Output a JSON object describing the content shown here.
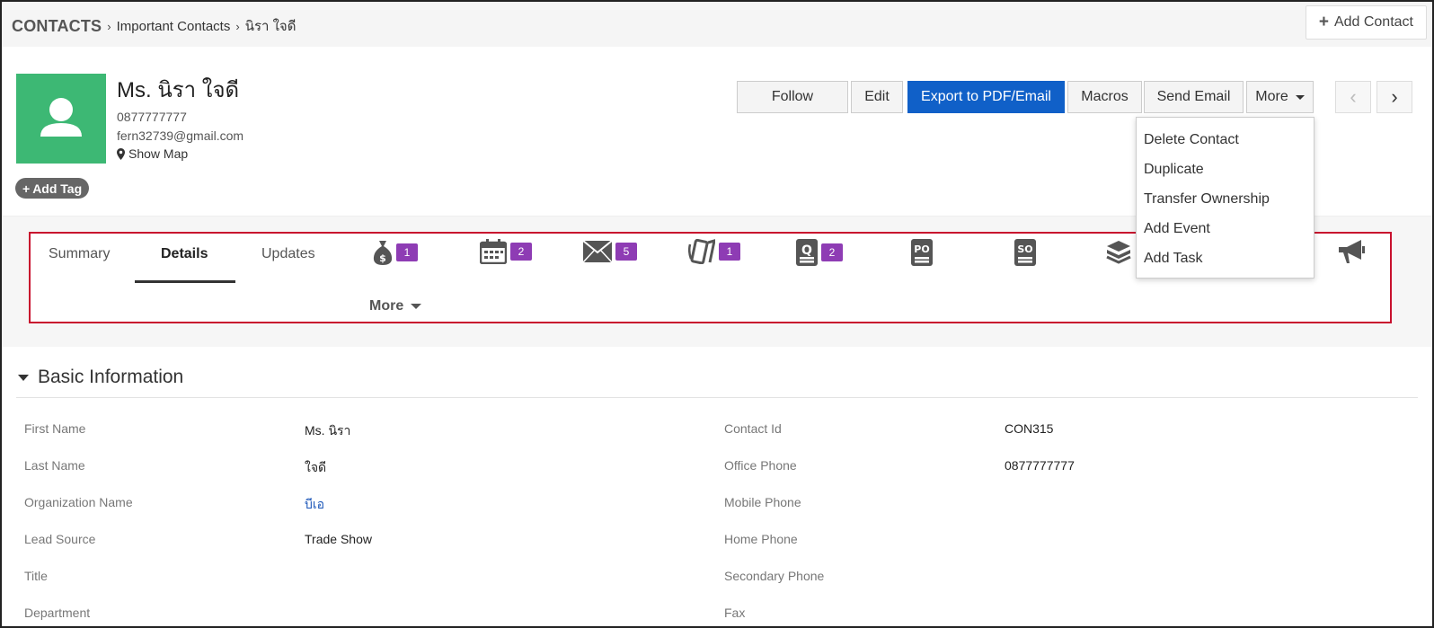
{
  "breadcrumb": {
    "root": "CONTACTS",
    "level1": "Important Contacts",
    "level2": "นิรา ใจดี"
  },
  "header_actions": {
    "add_contact": "Add Contact"
  },
  "contact": {
    "name": "Ms. นิรา ใจดี",
    "phone": "0877777777",
    "email": "fern32739@gmail.com",
    "show_map": "Show Map",
    "add_tag": "Add Tag",
    "avatar_color": "#3db874"
  },
  "actions": {
    "follow": "Follow",
    "edit": "Edit",
    "export": "Export to PDF/Email",
    "macros": "Macros",
    "send_email": "Send Email",
    "more": "More"
  },
  "more_menu": {
    "items": [
      "Delete Contact",
      "Duplicate",
      "Transfer Ownership",
      "Add Event",
      "Add Task"
    ]
  },
  "tabs": {
    "summary": "Summary",
    "details": "Details",
    "updates": "Updates",
    "more": "More",
    "icon_tabs": [
      {
        "icon": "money-bag-icon",
        "count": "1"
      },
      {
        "icon": "calendar-icon",
        "count": "2"
      },
      {
        "icon": "envelope-icon",
        "count": "5"
      },
      {
        "icon": "phone-call-icon",
        "count": "1"
      },
      {
        "icon": "quote-icon",
        "count": "2"
      },
      {
        "icon": "purchase-order-icon",
        "count": ""
      },
      {
        "icon": "sales-order-icon",
        "count": ""
      },
      {
        "icon": "box-icon",
        "count": ""
      },
      {
        "icon": "megaphone-icon",
        "count": ""
      }
    ]
  },
  "basic_info": {
    "title": "Basic Information",
    "left": [
      {
        "label": "First Name",
        "value": "Ms. นิรา"
      },
      {
        "label": "Last Name",
        "value": "ใจดี"
      },
      {
        "label": "Organization Name",
        "value": "บีเอ"
      },
      {
        "label": "Lead Source",
        "value": "Trade Show"
      },
      {
        "label": "Title",
        "value": ""
      },
      {
        "label": "Department",
        "value": ""
      }
    ],
    "right": [
      {
        "label": "Contact Id",
        "value": "CON315"
      },
      {
        "label": "Office Phone",
        "value": "0877777777"
      },
      {
        "label": "Mobile Phone",
        "value": ""
      },
      {
        "label": "Home Phone",
        "value": ""
      },
      {
        "label": "Secondary Phone",
        "value": ""
      },
      {
        "label": "Fax",
        "value": ""
      }
    ]
  },
  "colors": {
    "primary": "#1060c8",
    "badge": "#8e3cb4",
    "highlight_border": "#c8102e"
  }
}
